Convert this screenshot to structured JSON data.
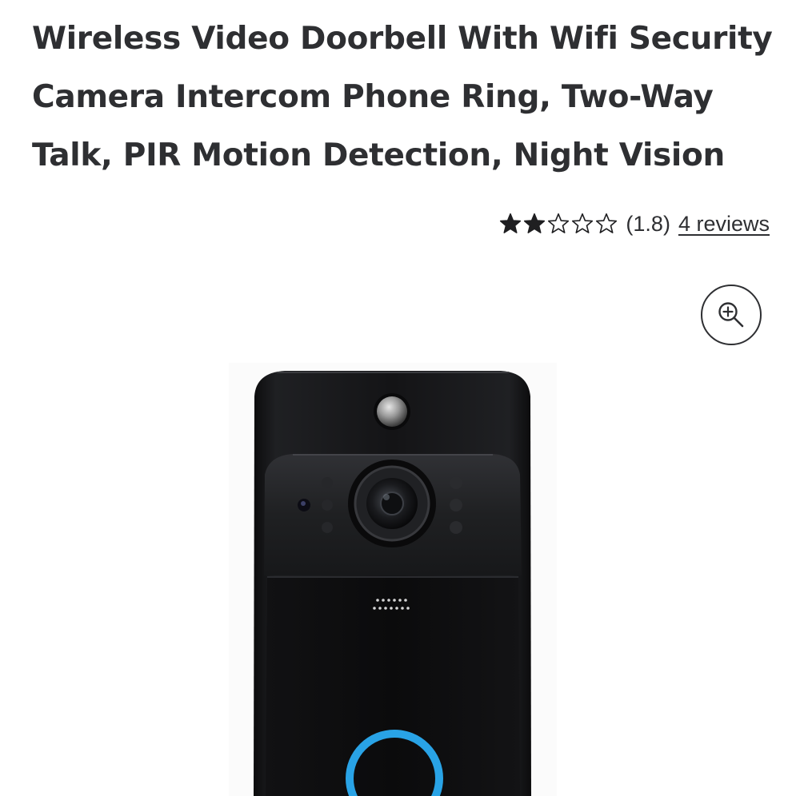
{
  "product": {
    "title": "Wireless Video Doorbell With Wifi Security Camera Intercom Phone Ring, Two-Way Talk, PIR Motion Detection, Night Vision",
    "rating": {
      "stars_filled": 2,
      "stars_total": 5,
      "value_text": "(1.8)",
      "reviews_text": "4 reviews"
    },
    "zoom": {
      "icon": "zoom-in-icon"
    },
    "image": {
      "subject": "doorbell-product-image",
      "ring_color": "#29a3e6"
    }
  }
}
